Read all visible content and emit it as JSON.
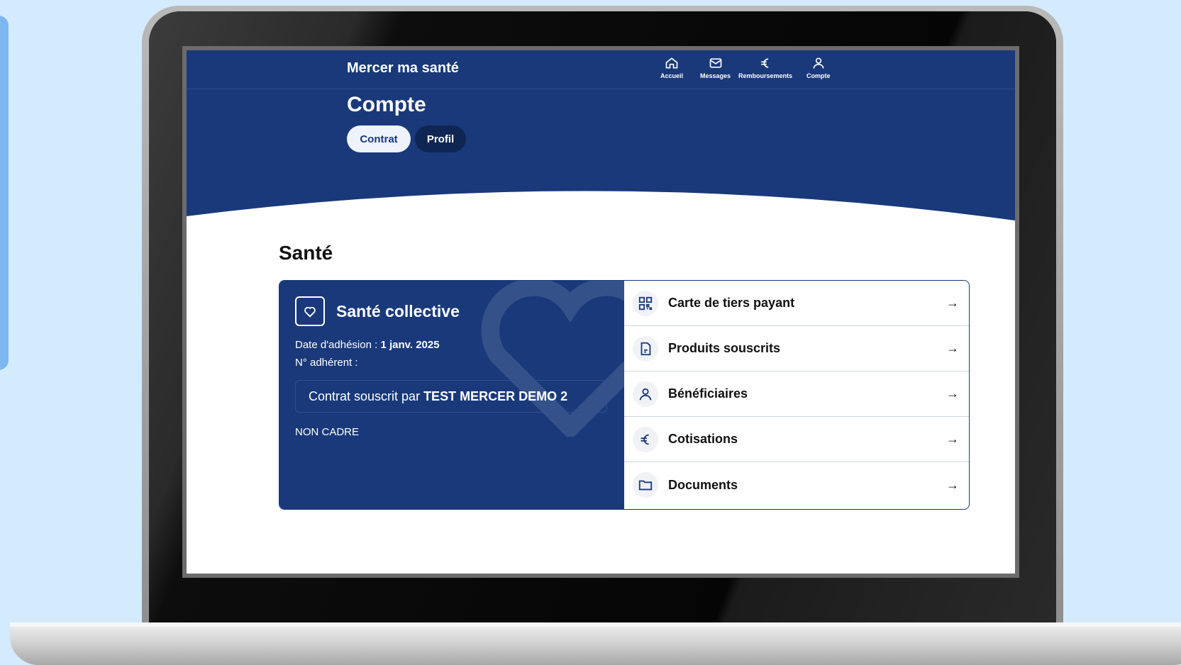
{
  "app": {
    "brand": "Mercer ma santé"
  },
  "nav": [
    {
      "label": "Accueil",
      "icon": "home-icon"
    },
    {
      "label": "Messages",
      "icon": "mail-icon"
    },
    {
      "label": "Remboursements",
      "icon": "euro-icon"
    },
    {
      "label": "Compte",
      "icon": "user-icon"
    }
  ],
  "page": {
    "title": "Compte",
    "tabs": [
      {
        "label": "Contrat",
        "active": true
      },
      {
        "label": "Profil",
        "active": false
      }
    ]
  },
  "section": {
    "title": "Santé"
  },
  "contract": {
    "title": "Santé collective",
    "adhesion_label": "Date d'adhésion : ",
    "adhesion_value": "1 janv. 2025",
    "member_label": "N° adhérent :",
    "subscribed_label": "Contrat souscrit par ",
    "subscribed_value": "TEST MERCER DEMO 2",
    "category": "NON CADRE"
  },
  "actions": [
    {
      "label": "Carte de tiers payant",
      "icon": "qr-code-icon"
    },
    {
      "label": "Produits souscrits",
      "icon": "document-icon"
    },
    {
      "label": "Bénéficiaires",
      "icon": "person-icon"
    },
    {
      "label": "Cotisations",
      "icon": "euro-icon"
    },
    {
      "label": "Documents",
      "icon": "folder-icon"
    }
  ],
  "colors": {
    "primary": "#19397a",
    "background": "#d3ebfd",
    "accent": "#7db7f2"
  }
}
